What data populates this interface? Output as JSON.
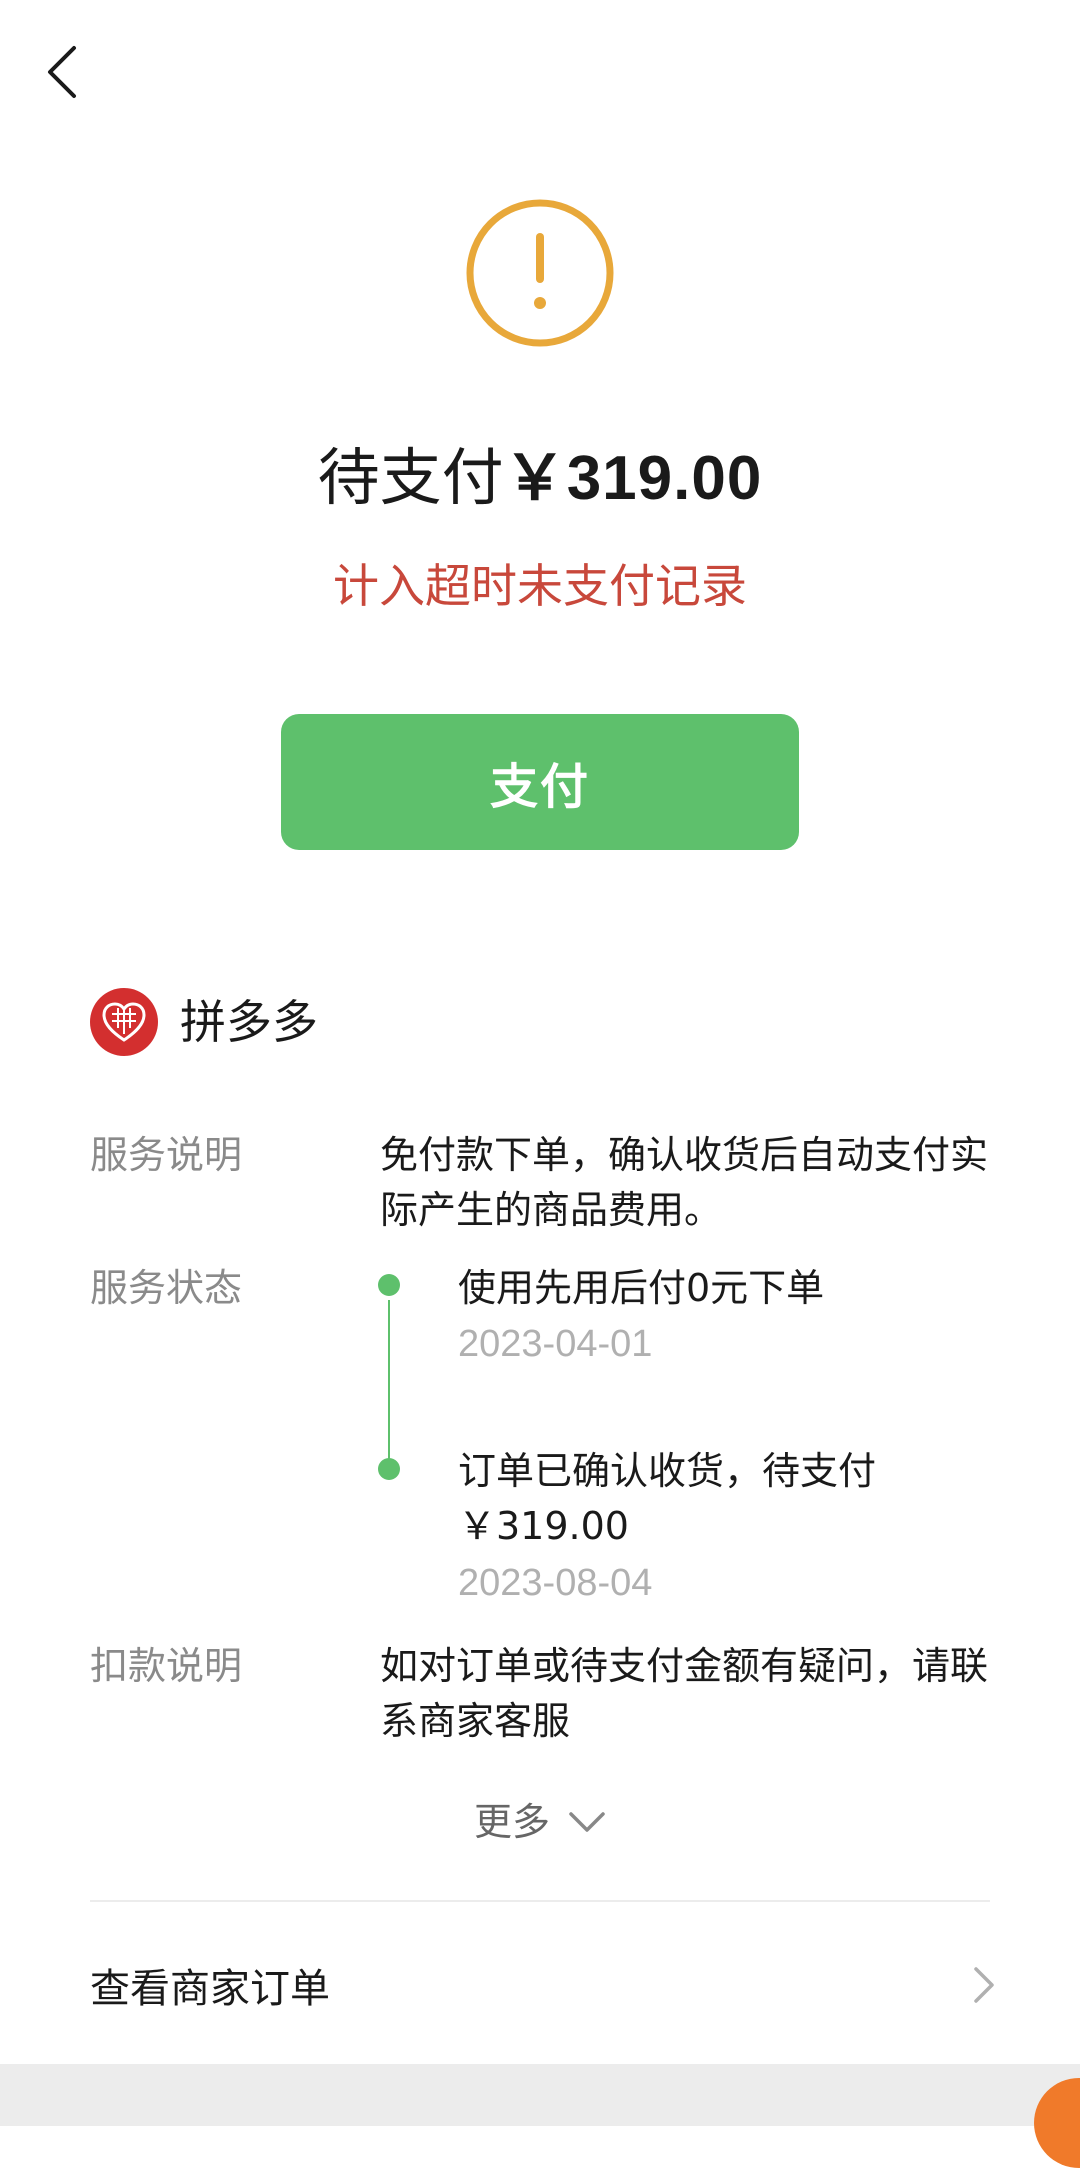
{
  "header": {
    "back_icon": "chevron-left-icon"
  },
  "status": {
    "icon": "exclamation-circle-icon",
    "icon_color": "#e8a83a",
    "title_prefix": "待支付",
    "amount": "￥319.00",
    "warning": "计入超时未支付记录",
    "warning_color": "#c8483b"
  },
  "pay_button": {
    "label": "支付",
    "color": "#5ec06c"
  },
  "merchant": {
    "name": "拼多多",
    "logo_color": "#d32f2f"
  },
  "details": {
    "service_desc_label": "服务说明",
    "service_desc_value": "免付款下单，确认收货后自动支付实际产生的商品费用。",
    "service_status_label": "服务状态",
    "timeline": [
      {
        "text": "使用先用后付0元下单",
        "date": "2023-04-01"
      },
      {
        "text": "订单已确认收货，待支付￥319.00",
        "date": "2023-08-04"
      }
    ],
    "deduction_label": "扣款说明",
    "deduction_value": "如对订单或待支付金额有疑问，请联系商家客服"
  },
  "more": {
    "label": "更多",
    "icon": "chevron-down-icon"
  },
  "order_link": {
    "label": "查看商家订单",
    "icon": "chevron-right-icon"
  }
}
